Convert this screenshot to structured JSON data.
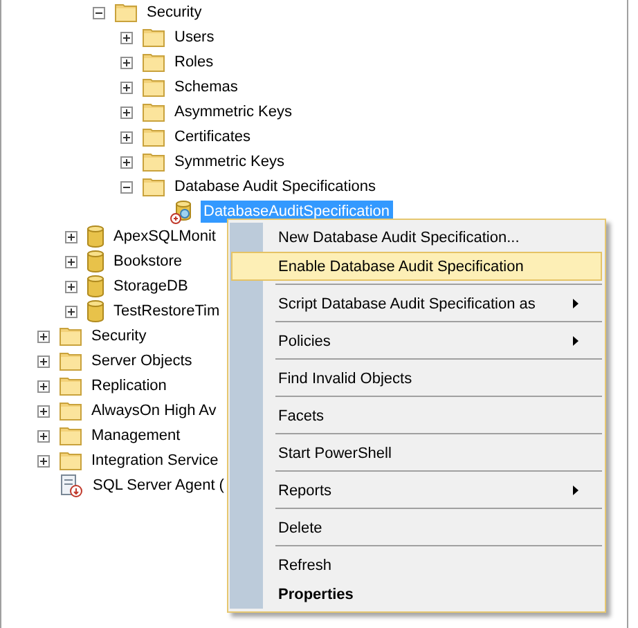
{
  "tree": [
    {
      "children": [
        {
          "children": [
            {
              "label": "Security",
              "expanded": true,
              "children": [
                {
                  "label": "Users",
                  "expanded": false
                },
                {
                  "label": "Roles",
                  "expanded": false
                },
                {
                  "label": "Schemas",
                  "expanded": false
                },
                {
                  "label": "Asymmetric Keys",
                  "expanded": false
                },
                {
                  "label": "Certificates",
                  "expanded": false
                },
                {
                  "label": "Symmetric Keys",
                  "expanded": false
                },
                {
                  "label": "Database Audit Specifications",
                  "expanded": true,
                  "children": [
                    {
                      "label": "DatabaseAuditSpecification",
                      "kind": "audit",
                      "selected": true
                    }
                  ]
                }
              ]
            }
          ]
        },
        {
          "label": "ApexSQLMonit",
          "kind": "database",
          "expanded": false,
          "selected": false
        },
        {
          "label": "Bookstore",
          "kind": "database",
          "expanded": false,
          "selected": false
        },
        {
          "label": "StorageDB",
          "kind": "database",
          "expanded": false,
          "selected": false
        },
        {
          "label": "TestRestoreTim",
          "kind": "database",
          "expanded": false,
          "selected": false
        }
      ]
    },
    {
      "label": "Security",
      "expanded": false
    },
    {
      "label": "Server Objects",
      "expanded": false
    },
    {
      "label": "Replication",
      "expanded": false
    },
    {
      "label": "AlwaysOn High Av",
      "expanded": false
    },
    {
      "label": "Management",
      "expanded": false
    },
    {
      "label": "Integration Service",
      "expanded": false
    },
    {
      "label": "SQL Server Agent (",
      "kind": "agent"
    }
  ],
  "context_menu": [
    {
      "kind": "item",
      "label": "New Database Audit Specification...",
      "selected": false
    },
    {
      "kind": "item",
      "label": "Enable Database Audit Specification",
      "selected": true
    },
    {
      "kind": "separator"
    },
    {
      "kind": "item",
      "label": "Script Database Audit Specification as",
      "selected": false,
      "submenu": true
    },
    {
      "kind": "separator"
    },
    {
      "kind": "item",
      "label": "Policies",
      "selected": false,
      "submenu": true
    },
    {
      "kind": "separator"
    },
    {
      "kind": "item",
      "label": "Find Invalid Objects",
      "selected": false
    },
    {
      "kind": "separator"
    },
    {
      "kind": "item",
      "label": "Facets",
      "selected": false
    },
    {
      "kind": "separator"
    },
    {
      "kind": "item",
      "label": "Start PowerShell",
      "selected": false
    },
    {
      "kind": "separator"
    },
    {
      "kind": "item",
      "label": "Reports",
      "selected": false,
      "submenu": true
    },
    {
      "kind": "separator"
    },
    {
      "kind": "item",
      "label": "Delete",
      "selected": false
    },
    {
      "kind": "separator"
    },
    {
      "kind": "item",
      "label": "Refresh",
      "selected": false
    },
    {
      "kind": "item",
      "label": "Properties",
      "selected": false,
      "default": true
    }
  ]
}
